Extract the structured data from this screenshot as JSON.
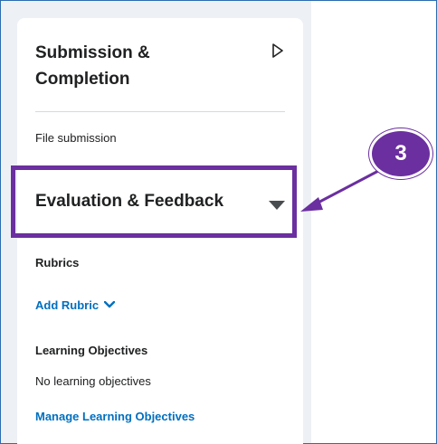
{
  "submission": {
    "title_line1": "Submission &",
    "title_line2": "Completion",
    "summary": "File submission",
    "chevron_icon": "chevron-right-icon"
  },
  "evaluation": {
    "title": "Evaluation & Feedback",
    "caret_icon": "caret-down-icon"
  },
  "rubrics": {
    "label": "Rubrics",
    "add_link": "Add Rubric",
    "add_chevron_icon": "chevron-down-icon"
  },
  "learning_objectives": {
    "label": "Learning Objectives",
    "empty_text": "No learning objectives",
    "manage_link": "Manage Learning Objectives"
  },
  "annotation": {
    "step_number": "3",
    "highlight_color": "#6b2fa0"
  },
  "colors": {
    "link": "#006fbf",
    "text": "#202122",
    "panel_background": "#edf0f5"
  }
}
